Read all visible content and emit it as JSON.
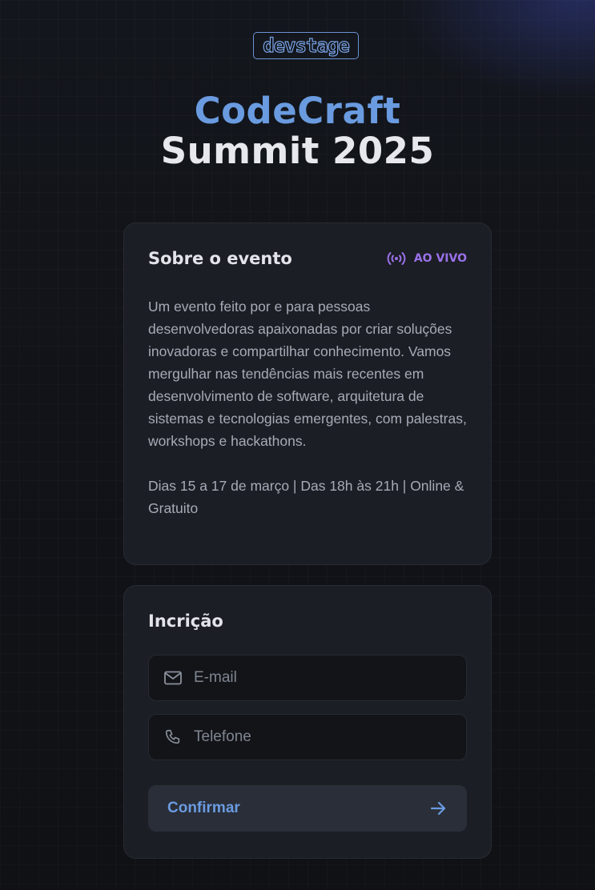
{
  "logo": {
    "text": "devstage"
  },
  "hero": {
    "line1": "CodeCraft",
    "line2": "Summit 2025"
  },
  "about": {
    "title": "Sobre o evento",
    "live_badge": {
      "icon": "broadcast-icon",
      "label": "AO VIVO",
      "color": "#9a71ea"
    },
    "description": "Um evento feito por e para pessoas desenvolvedoras apaixonadas por criar soluções inovadoras e compartilhar conhecimento. Vamos mergulhar nas tendências mais recentes em desenvolvimento de software, arquitetura de sistemas e tecnologias emergentes, com palestras, workshops e hackathons.",
    "details": "Dias 15 a 17 de março | Das 18h às 21h | Online & Gratuito"
  },
  "form": {
    "title": "Incrição",
    "email": {
      "icon": "mail-icon",
      "placeholder": "E-mail",
      "value": ""
    },
    "phone": {
      "icon": "phone-icon",
      "placeholder": "Telefone",
      "value": ""
    },
    "submit": {
      "label": "Confirmar",
      "icon": "arrow-right-icon"
    }
  },
  "colors": {
    "accent_blue": "#6a9be0",
    "accent_purple": "#9a71ea",
    "card_bg": "#1b1e24",
    "page_bg": "#121418"
  }
}
